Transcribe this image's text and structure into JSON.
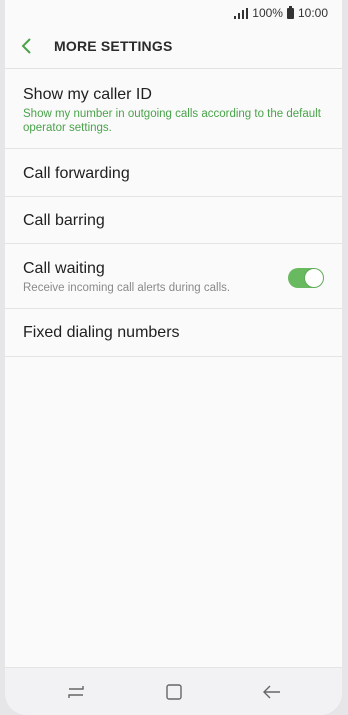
{
  "status_bar": {
    "battery": "100%",
    "time": "10:00",
    "signal_icon": "signal-bars-icon",
    "battery_icon": "battery-icon"
  },
  "header": {
    "back_icon": "chevron-left-icon",
    "title": "MORE SETTINGS"
  },
  "settings": [
    {
      "title": "Show my caller ID",
      "subtitle": "Show my number in outgoing calls according to the default operator settings."
    },
    {
      "title": "Call forwarding"
    },
    {
      "title": "Call barring"
    },
    {
      "title": "Call waiting",
      "subtitle": "Receive incoming call alerts during calls.",
      "toggle_on": true
    },
    {
      "title": "Fixed dialing numbers"
    }
  ],
  "colors": {
    "accent": "#4aa34b",
    "toggle_on": "#68b95f"
  },
  "nav_bar": {
    "recents_icon": "recents-icon",
    "home_icon": "home-icon",
    "back_icon": "back-arrow-icon"
  }
}
